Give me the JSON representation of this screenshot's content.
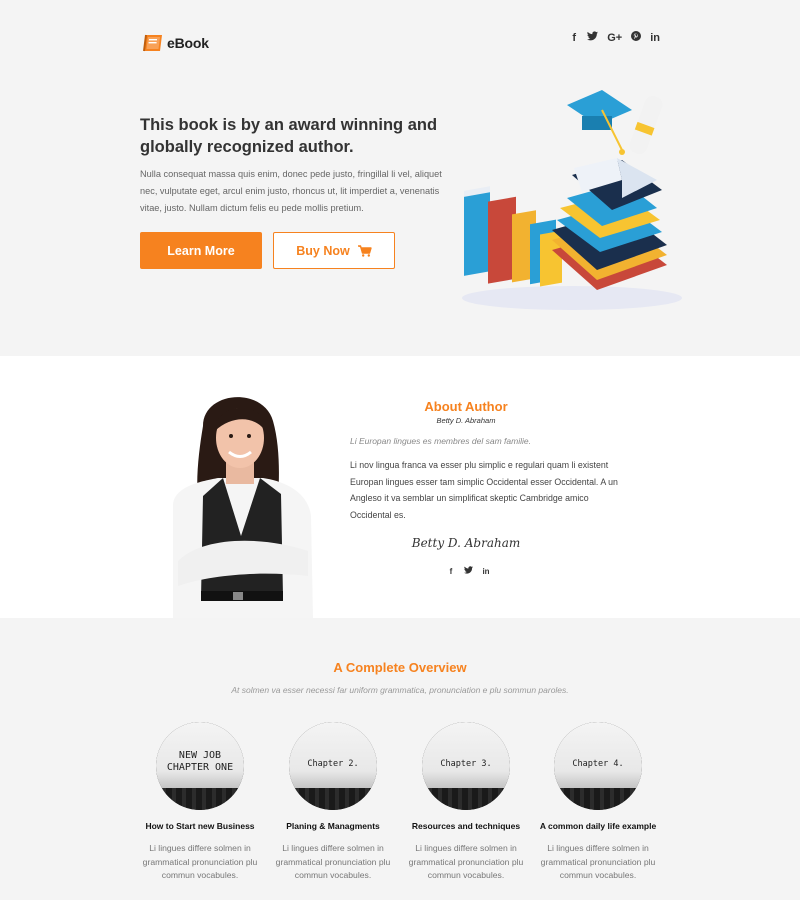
{
  "header": {
    "logo_text": "eBook",
    "socials": [
      "f",
      "t",
      "G+",
      "p",
      "in"
    ]
  },
  "hero": {
    "title": "This book is by an award winning and globally recognized author.",
    "text": "Nulla consequat massa quis enim, donec pede justo, fringillal li vel, aliquet nec, vulputate eget, arcul enim justo, rhoncus ut, lit imperdiet a, venenatis vitae, justo. Nullam dictum felis eu pede mollis pretium.",
    "learn_more_label": "Learn More",
    "buy_now_label": "Buy Now"
  },
  "about": {
    "title": "About Author",
    "author_name": "Betty D. Abraham",
    "quote": "Li Europan lingues es membres del sam familie.",
    "body": "Li nov lingua franca va esser plu simplic e regulari quam li existent Europan lingues esser tam simplic Occidental esser Occidental. A un Angleso it va semblar un simplificat skeptic Cambridge amico Occidental es.",
    "signature": "Betty D. Abraham",
    "socials": [
      "f",
      "t",
      "in"
    ]
  },
  "overview": {
    "title": "A Complete Overview",
    "subtitle": "At solmen va esser necessi far uniform grammatica, pronunciation e plu sommun paroles.",
    "cards": [
      {
        "image_text": "NEW JOB\nCHAPTER ONE",
        "title": "How to Start new Business",
        "text": "Li lingues differe solmen in grammatical  pronunciation plu commun vocabules."
      },
      {
        "image_text": "Chapter 2.",
        "title": "Planing & Managments",
        "text": "Li lingues differe solmen in grammatical  pronunciation plu commun vocabules."
      },
      {
        "image_text": "Chapter 3.",
        "title": "Resources and techniques",
        "text": "Li lingues differe solmen in grammatical  pronunciation plu commun vocabules."
      },
      {
        "image_text": "Chapter 4.",
        "title": "A common daily life example",
        "text": "Li lingues differe solmen in grammatical  pronunciation plu commun vocabules."
      }
    ]
  },
  "colors": {
    "accent": "#f6821f",
    "dark": "#333333"
  }
}
